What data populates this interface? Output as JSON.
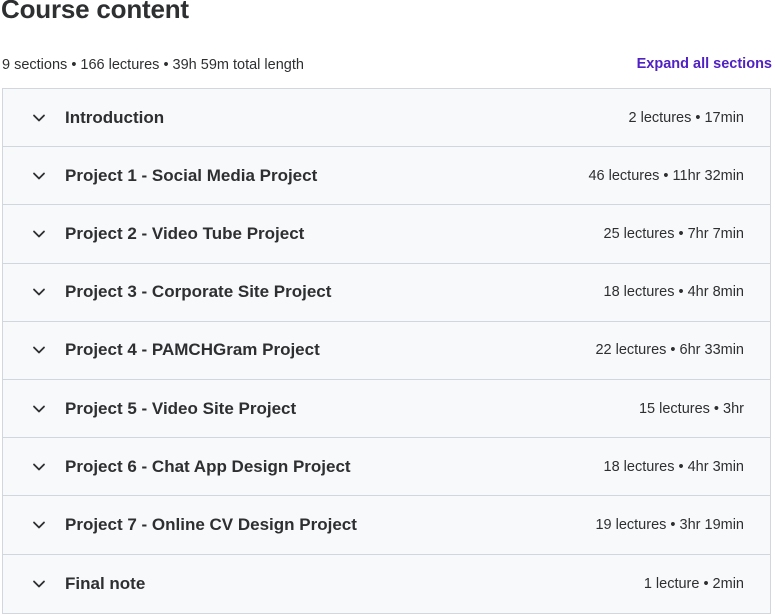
{
  "header": {
    "title": "Course content",
    "summary": "9 sections • 166 lectures • 39h 59m total length",
    "expand_all_label": "Expand all sections"
  },
  "icons": {
    "section_toggle": "chevron-down-icon"
  },
  "colors": {
    "accent": "#5022c3",
    "row_background": "#f7f9fa",
    "border": "#d1d7dc",
    "text": "#2d2f31"
  },
  "sections": [
    {
      "title": "Introduction",
      "meta": "2 lectures • 17min"
    },
    {
      "title": "Project 1 - Social Media Project",
      "meta": "46 lectures • 11hr 32min"
    },
    {
      "title": "Project 2 - Video Tube Project",
      "meta": "25 lectures • 7hr 7min"
    },
    {
      "title": "Project 3 - Corporate Site Project",
      "meta": "18 lectures • 4hr 8min"
    },
    {
      "title": "Project 4 - PAMCHGram Project",
      "meta": "22 lectures • 6hr 33min"
    },
    {
      "title": "Project 5 - Video Site Project",
      "meta": "15 lectures • 3hr"
    },
    {
      "title": "Project 6 - Chat App Design Project",
      "meta": "18 lectures • 4hr 3min"
    },
    {
      "title": "Project 7 - Online CV Design Project",
      "meta": "19 lectures • 3hr 19min"
    },
    {
      "title": "Final note",
      "meta": "1 lecture • 2min"
    }
  ]
}
